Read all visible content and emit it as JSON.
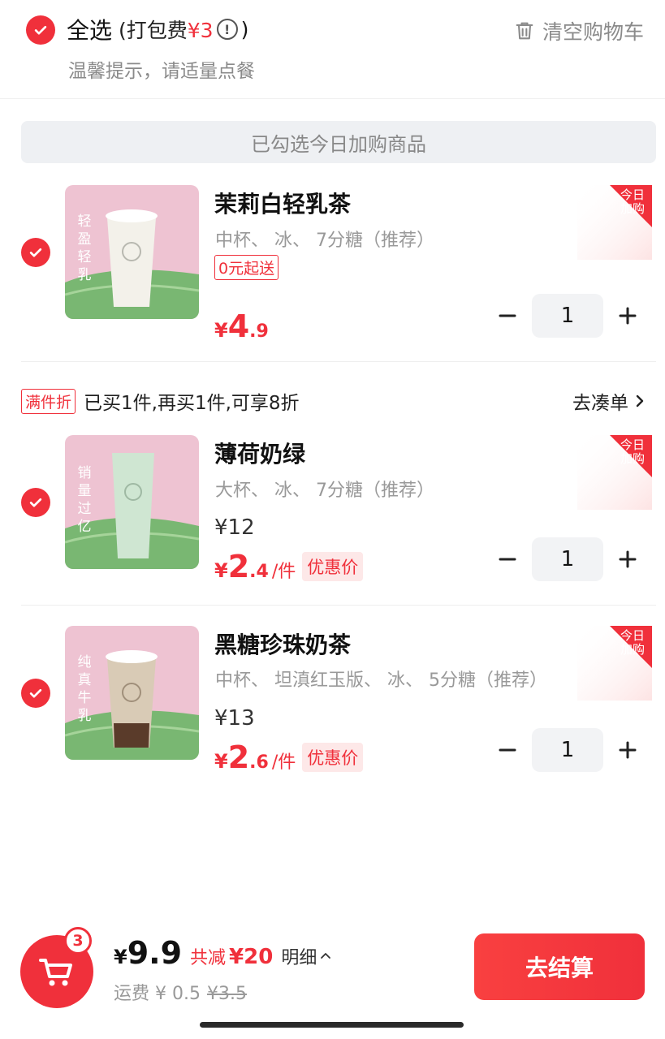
{
  "header": {
    "select_all": "全选",
    "packing_fee_prefix": "(打包费",
    "packing_fee": "¥3",
    "packing_fee_suffix": ")",
    "clear_cart": "清空购物车",
    "tip": "温馨提示，请适量点餐"
  },
  "banner": "已勾选今日加购商品",
  "corner_badge": "今日加购",
  "items": [
    {
      "name": "茉莉白轻乳茶",
      "spec": "中杯、 冰、 7分糖（推荐）",
      "tag": "0元起送",
      "price_symbol": "¥",
      "price_int": "4",
      "price_dec": ".9",
      "quantity": "1",
      "image_text": "轻盈轻乳",
      "image_colors": {
        "drink": "#f3f1ea"
      }
    },
    {
      "name": "薄荷奶绿",
      "spec": "大杯、 冰、 7分糖（推荐）",
      "original_price": "¥12",
      "price_symbol": "¥",
      "price_int": "2",
      "price_dec": ".4",
      "price_unit": "/件",
      "deal_label": "优惠价",
      "quantity": "1",
      "image_text": "销量过亿",
      "image_colors": {
        "drink": "#cfe6d2"
      }
    },
    {
      "name": "黑糖珍珠奶茶",
      "spec": "中杯、 坦滇红玉版、 冰、 5分糖（推荐）",
      "original_price": "¥13",
      "price_symbol": "¥",
      "price_int": "2",
      "price_dec": ".6",
      "price_unit": "/件",
      "deal_label": "优惠价",
      "quantity": "1",
      "image_text": "纯真牛乳",
      "image_colors": {
        "drink": "#d9cbb6"
      }
    }
  ],
  "promo": {
    "tag": "满件折",
    "text": "已买1件,再买1件,可享8折",
    "link": "去凑单"
  },
  "footer": {
    "cart_count": "3",
    "total_symbol": "¥",
    "total": "9.9",
    "savings_label": "共减",
    "savings": "¥20",
    "detail": "明细",
    "shipping_label": "运费 ¥ 0.5",
    "shipping_original": "¥3.5",
    "checkout": "去结算"
  },
  "colors": {
    "accent": "#f0303b",
    "muted_text": "#999999",
    "banner_bg": "#eef0f3"
  },
  "icons": [
    "check-icon",
    "info-icon",
    "trash-icon",
    "minus-icon",
    "plus-icon",
    "chevron-right-icon",
    "chevron-up-icon",
    "cart-icon"
  ]
}
